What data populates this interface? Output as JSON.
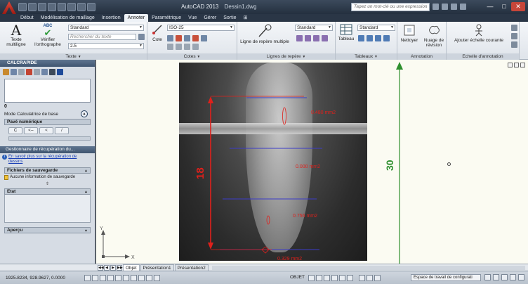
{
  "titlebar": {
    "app_name": "AutoCAD 2013",
    "doc_name": "Dessin1.dwg",
    "search_placeholder": "Tapez un mot-clé ou une expression",
    "min_label": "—",
    "max_label": "□",
    "close_label": "✕"
  },
  "ribbon_tabs": [
    "Début",
    "Modélisation de maillage",
    "Insertion",
    "Annoter",
    "Paramétrique",
    "Vue",
    "Gérer",
    "Sortie",
    "⊞"
  ],
  "ribbon": {
    "texte": {
      "title": "Texte",
      "multiline_label_1": "Texte",
      "multiline_label_2": "multiligne",
      "check_label_1": "Vérifier",
      "check_label_2": "l'orthographe",
      "abc": "ABC",
      "style_value": "Standard",
      "search_placeholder": "Rechercher du texte",
      "height_value": "2.5"
    },
    "cotes": {
      "title": "Cotes",
      "cote_label": "Cote",
      "style_value": "ISO-25"
    },
    "reperes": {
      "title": "Lignes de repère",
      "multi_label": "Ligne de repère multiple",
      "style_value": "Standard"
    },
    "tableaux": {
      "title": "Tableaux",
      "tableau_label": "Tableau",
      "style_value": "Standard"
    },
    "annotation": {
      "title": "Annotation",
      "nettoyer_label": "Nettoyer",
      "nuage_label_1": "Nuage de",
      "nuage_label_2": "révision"
    },
    "echelle": {
      "title": "Echelle d'annotation",
      "ajouter_label": "Ajouter échelle courante"
    }
  },
  "calc": {
    "title": "CALCRAPIDE",
    "value": "0",
    "mode_label": "Mode Calculatrice de base",
    "pav_label": "Pavé numérique",
    "keys": [
      "C",
      "<--",
      "<",
      "/"
    ]
  },
  "recovery": {
    "title": "Gestionnaire de récupération du...",
    "link": "En savoir plus sur la récupération de dessins",
    "backup_header": "Fichiers de sauvegarde",
    "no_backup": "Aucune information de sauvegarde",
    "etat_header": "Etat",
    "apercu_header": "Aperçu"
  },
  "drawing": {
    "dim_left": "18",
    "dim_right": "30",
    "area_labels": [
      "0.480 mm2",
      "0.000 mm2",
      "0.756 mm2",
      "0.329 mm2"
    ],
    "ucs_x": "X",
    "ucs_y": "Y",
    "colors": {
      "red": "#e0201b",
      "green": "#2e8f2e",
      "blue": "#3c3cc8"
    }
  },
  "layout_tabs": [
    "Objet",
    "Présentation1",
    "Présentation2"
  ],
  "status": {
    "coords": "1925.8234, 928.9627, 0.0000",
    "objet_label": "OBJET",
    "workspace": "Espace de travail de configurati"
  }
}
